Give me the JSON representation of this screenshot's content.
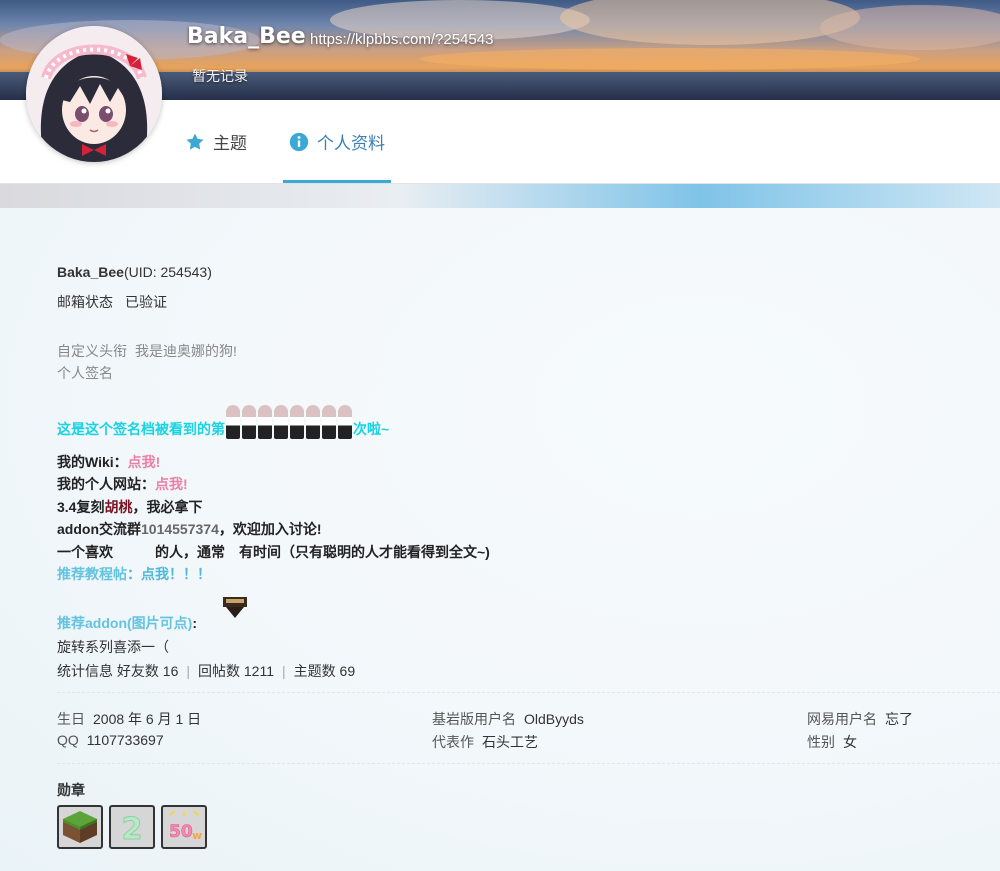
{
  "header": {
    "username": "Baka_Bee",
    "url": "https://klpbbs.com/?254543",
    "status": "暂无记录"
  },
  "tabs": [
    {
      "label": "主题",
      "icon": "star-icon"
    },
    {
      "label": "个人资料",
      "icon": "info-icon",
      "active": true
    }
  ],
  "profile": {
    "username": "Baka_Bee",
    "uid_text": "(UID: 254543)",
    "email_label": "邮箱状态",
    "email_value": "已验证",
    "title_label": "自定义头衔",
    "title_value": "我是迪奥娜的狗!",
    "signature_label": "个人签名"
  },
  "signature": {
    "counter_prefix": "这是这个签名档被看到的第",
    "counter_suffix": "次啦~",
    "wiki_label": "我的Wiki：",
    "wiki_link": "点我!",
    "site_label": "我的个人网站：",
    "site_link": "点我!",
    "line3_a": "3.4复刻",
    "line3_b": "胡桃",
    "line3_c": "，我必拿下",
    "line4_a": "addon交流群",
    "line4_b": "1014557374",
    "line4_c": "，欢迎加入讨论!",
    "line5_a": "一个喜欢",
    "line5_b": "的人，通常",
    "line5_c": "有时间（只有聪明的人才能看得到全文~)",
    "tutorial_label": "推荐教程帖",
    "tutorial_link": "：点我！！！",
    "addon_label": "推荐addon(图片可点)",
    "addon_colon": ":",
    "addon_text": "旋转系列喜添一（"
  },
  "stats": {
    "label": "统计信息",
    "friends_label": "好友数",
    "friends": "16",
    "replies_label": "回帖数",
    "replies": "1211",
    "topics_label": "主题数",
    "topics": "69"
  },
  "info": {
    "birthday_label": "生日",
    "birthday": "2008 年 6 月 1 日",
    "qq_label": "QQ",
    "qq": "1107733697",
    "bedrock_label": "基岩版用户名",
    "bedrock": "OldByyds",
    "work_label": "代表作",
    "work": "石头工艺",
    "netease_label": "网易用户名",
    "netease": "忘了",
    "gender_label": "性别",
    "gender": "女"
  },
  "medals": {
    "label": "勋章",
    "items": [
      "grass-block-medal-icon",
      "number-2-medal-icon",
      "50w-medal-icon"
    ]
  }
}
